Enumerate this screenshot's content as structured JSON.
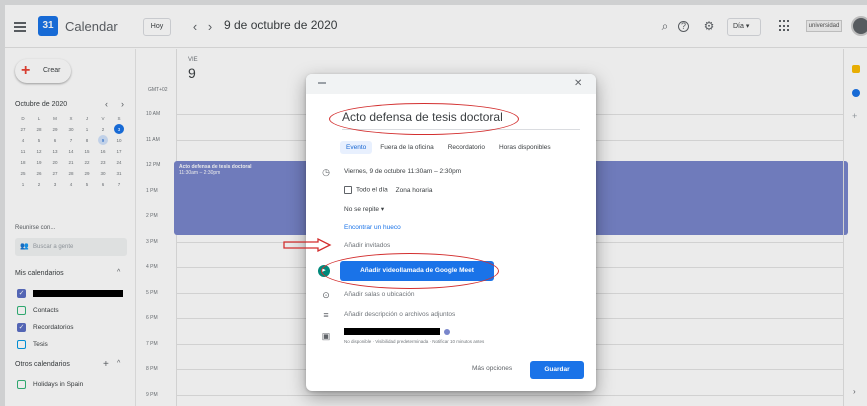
{
  "header": {
    "app_title": "Calendar",
    "logo_text": "31",
    "today_label": "Hoy",
    "prev_icon": "chevron-left-icon",
    "next_icon": "chevron-right-icon",
    "date_title": "9 de octubre de 2020",
    "view_label": "Día",
    "org_logo_text": "universidad"
  },
  "sidebar": {
    "create_label": "Crear",
    "mini_calendar": {
      "month_title": "Octubre de 2020",
      "weekdays": [
        "D",
        "L",
        "M",
        "X",
        "J",
        "V",
        "S"
      ],
      "weeks": [
        [
          "27",
          "28",
          "29",
          "30",
          "1",
          "2",
          "3"
        ],
        [
          "4",
          "5",
          "6",
          "7",
          "8",
          "9",
          "10"
        ],
        [
          "11",
          "12",
          "13",
          "14",
          "15",
          "16",
          "17"
        ],
        [
          "18",
          "19",
          "20",
          "21",
          "22",
          "23",
          "24"
        ],
        [
          "25",
          "26",
          "27",
          "28",
          "29",
          "30",
          "31"
        ],
        [
          "1",
          "2",
          "3",
          "4",
          "5",
          "6",
          "7"
        ]
      ],
      "today": "3",
      "selected": "9"
    },
    "meet_label": "Reunirse con...",
    "search_people_placeholder": "Buscar a gente",
    "my_calendars_label": "Mis calendarios",
    "my_calendars": [
      {
        "label": "",
        "checked": true,
        "redacted": true
      },
      {
        "label": "Contacts",
        "checked": false
      },
      {
        "label": "Recordatorios",
        "checked": true
      },
      {
        "label": "Tesis",
        "checked": false
      }
    ],
    "other_calendars_label": "Otros calendarios",
    "other_calendars": [
      {
        "label": "Holidays in Spain",
        "checked": false
      }
    ]
  },
  "main": {
    "day_name": "VIE",
    "day_number": "9",
    "timezone": "GMT+02",
    "hours": [
      "10 AM",
      "11 AM",
      "12 PM",
      "1 PM",
      "2 PM",
      "3 PM",
      "4 PM",
      "5 PM",
      "6 PM",
      "7 PM",
      "8 PM",
      "9 PM"
    ],
    "event": {
      "title": "Acto defensa de tesis doctoral",
      "time": "11:30am – 2:30pm"
    }
  },
  "dialog": {
    "title_value": "Acto defensa de tesis doctoral",
    "tabs": [
      "Evento",
      "Fuera de la oficina",
      "Recordatorio",
      "Horas disponibles"
    ],
    "active_tab": "Evento",
    "datetime": "Viernes, 9 de octubre   11:30am  –  2:30pm",
    "all_day_label": "Todo el día",
    "timezone_label": "Zona horaria",
    "repeat_label": "No se repite",
    "find_time_label": "Encontrar un hueco",
    "add_guests_label": "Añadir invitados",
    "meet_button_label": "Añadir videollamada de Google Meet",
    "location_label": "Añadir salas o ubicación",
    "description_label": "Añadir descripción o archivos adjuntos",
    "calendar_meta": "No disponible · Visibilidad predeterminada · Notificar 10 minutos antes",
    "more_options_label": "Más opciones",
    "save_label": "Guardar"
  },
  "colors": {
    "primary": "#1a73e8",
    "event": "#7986cb",
    "annotation": "#d32f2f"
  }
}
